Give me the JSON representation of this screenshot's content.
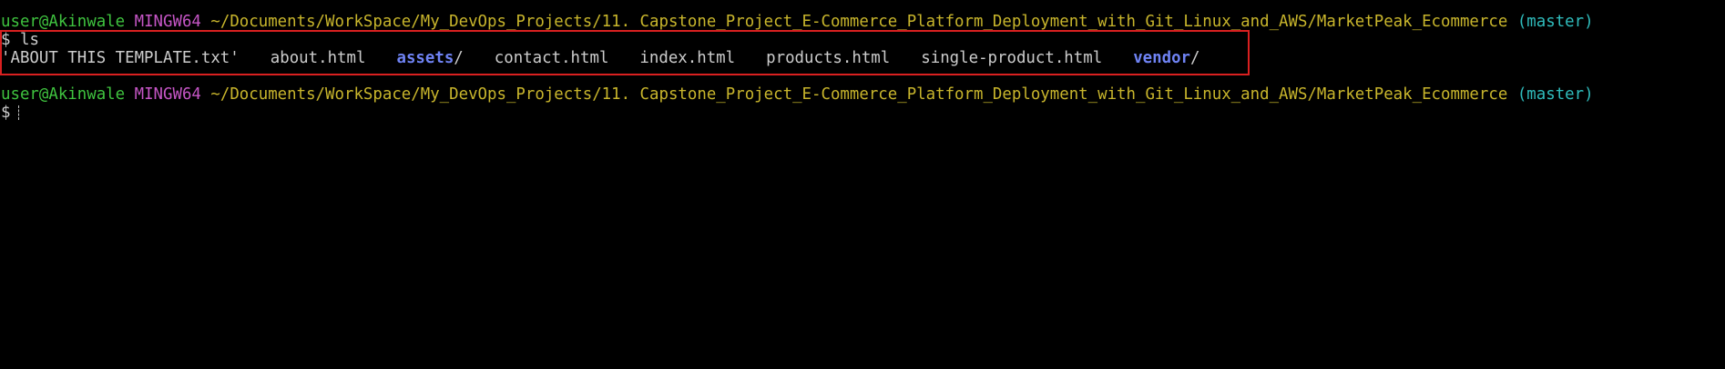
{
  "prompt_1": {
    "user_host": "user@Akinwale",
    "system": "MINGW64",
    "path": "~/Documents/WorkSpace/My_DevOps_Projects/11. Capstone_Project_E-Commerce_Platform_Deployment_with_Git_Linux_and_AWS/MarketPeak_Ecommerce",
    "branch": "(master)"
  },
  "command_line": {
    "symbol": "$",
    "command": "ls"
  },
  "listing": {
    "entries": [
      {
        "name": "'ABOUT THIS TEMPLATE.txt'",
        "type": "file"
      },
      {
        "name": "about.html",
        "type": "file"
      },
      {
        "name": "assets",
        "suffix": "/",
        "type": "directory"
      },
      {
        "name": "contact.html",
        "type": "file"
      },
      {
        "name": "index.html",
        "type": "file"
      },
      {
        "name": "products.html",
        "type": "file"
      },
      {
        "name": "single-product.html",
        "type": "file"
      },
      {
        "name": "vendor",
        "suffix": "/",
        "type": "directory"
      }
    ]
  },
  "prompt_2": {
    "user_host": "user@Akinwale",
    "system": "MINGW64",
    "path": "~/Documents/WorkSpace/My_DevOps_Projects/11. Capstone_Project_E-Commerce_Platform_Deployment_with_Git_Linux_and_AWS/MarketPeak_Ecommerce",
    "branch": "(master)"
  },
  "input_line": {
    "symbol": "$"
  },
  "colors": {
    "background": "#000000",
    "user_host": "#3fc33f",
    "system": "#c656c6",
    "path": "#c8b52c",
    "branch": "#2fbcbc",
    "directory": "#6f83f4",
    "text": "#cccccc",
    "highlight_box": "#d92020"
  }
}
